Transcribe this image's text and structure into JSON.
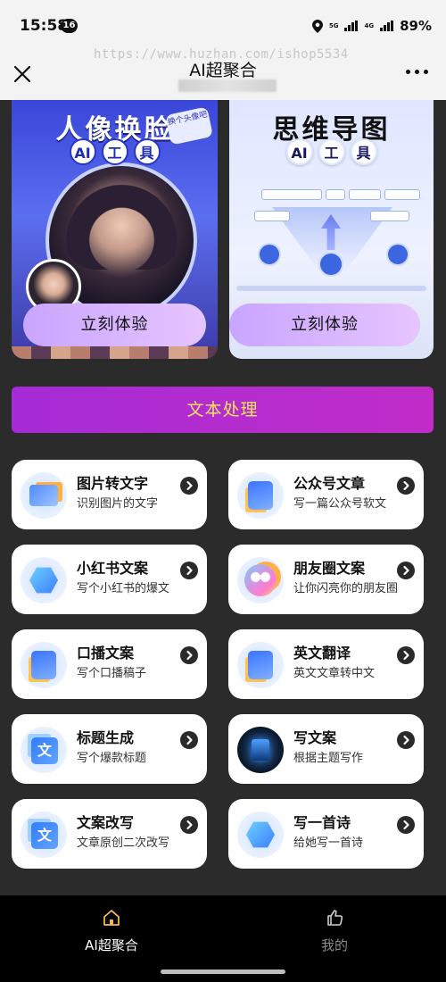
{
  "status_bar": {
    "time": "15:58",
    "notification_count": "16",
    "network_a": "5G",
    "network_b": "4G",
    "battery": "89%"
  },
  "header": {
    "title": "AI超聚合",
    "watermark": "https://www.huzhan.com/ishop5534"
  },
  "banners": [
    {
      "title": "人像换脸",
      "chips": [
        "AI",
        "工",
        "具"
      ],
      "sticker": "换个头像吧",
      "cta": "立刻体验"
    },
    {
      "title": "思维导图",
      "chips": [
        "AI",
        "工",
        "具"
      ],
      "cta": "立刻体验"
    }
  ],
  "section": {
    "label": "文本处理"
  },
  "cards": [
    {
      "title": "图片转文字",
      "subtitle": "识别图片的文字",
      "icon": "image-text-icon"
    },
    {
      "title": "公众号文章",
      "subtitle": "写一篇公众号软文",
      "icon": "article-icon"
    },
    {
      "title": "小红书文案",
      "subtitle": "写个小红书的爆文",
      "icon": "xiaohongshu-icon"
    },
    {
      "title": "朋友圈文案",
      "subtitle": "让你闪亮你的朋友圈",
      "icon": "moments-icon"
    },
    {
      "title": "口播文案",
      "subtitle": "写个口播稿子",
      "icon": "voice-script-icon"
    },
    {
      "title": "英文翻译",
      "subtitle": "英文文章转中文",
      "icon": "translate-icon"
    },
    {
      "title": "标题生成",
      "subtitle": "写个爆款标题",
      "icon": "title-icon"
    },
    {
      "title": "写文案",
      "subtitle": "根据主题写作",
      "icon": "copywriting-icon"
    },
    {
      "title": "文案改写",
      "subtitle": "文章原创二次改写",
      "icon": "rewrite-icon"
    },
    {
      "title": "写一首诗",
      "subtitle": "给她写一首诗",
      "icon": "poem-icon"
    }
  ],
  "nav": {
    "items": [
      {
        "label": "AI超聚合",
        "icon": "home-icon",
        "active": true
      },
      {
        "label": "我的",
        "icon": "thumbs-up-icon",
        "active": false
      }
    ]
  },
  "colors": {
    "background": "#2b2b2b",
    "section_gradient": "#b02bd4",
    "section_text": "#f4e45a",
    "nav_active": "#ffffff",
    "nav_inactive": "#8a8a8a",
    "cta": "#d9b6ff"
  }
}
